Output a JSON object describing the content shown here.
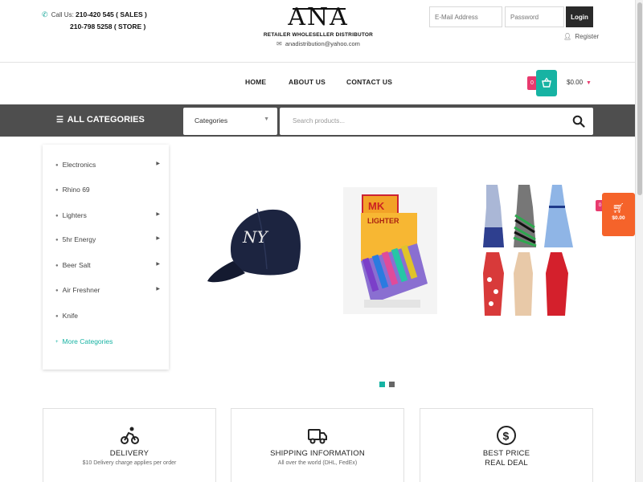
{
  "header": {
    "call_label": "Call Us:",
    "phone_sales": "210-420 545 ( SALES )",
    "phone_store": "210-798 5258 ( STORE )",
    "logo_text": "ANA",
    "tagline": "RETAILER WHOLESELLER DISTRIBUTOR",
    "email": "anadistribution@yahoo.com",
    "email_placeholder": "E-Mail Address",
    "password_placeholder": "Password",
    "login_label": "Login",
    "register_label": "Register"
  },
  "nav": {
    "items": [
      "HOME",
      "ABOUT US",
      "CONTACT US"
    ],
    "cart_count": "0",
    "cart_total": "$0.00"
  },
  "catbar": {
    "all_categories_label": "ALL CATEGORIES",
    "category_select_value": "Categories",
    "search_placeholder": "Search products..."
  },
  "sidebar": {
    "items": [
      {
        "label": "Electronics",
        "has_submenu": true
      },
      {
        "label": "Rhino 69",
        "has_submenu": false
      },
      {
        "label": "Lighters",
        "has_submenu": true
      },
      {
        "label": "5hr Energy",
        "has_submenu": true
      },
      {
        "label": "Beer Salt",
        "has_submenu": true
      },
      {
        "label": "Air Freshner",
        "has_submenu": true
      },
      {
        "label": "Knife",
        "has_submenu": false
      }
    ],
    "more_label": "More Categories"
  },
  "slider": {
    "products": [
      "cap",
      "lighter-box",
      "dresses"
    ],
    "active_index": 0,
    "count": 2
  },
  "floating_cart": {
    "count": "0",
    "total": "$0.00"
  },
  "features": [
    {
      "icon": "delivery-icon",
      "title": "DELIVERY",
      "subtitle": "$10 Delivery charge applies per order"
    },
    {
      "icon": "truck-icon",
      "title": "SHIPPING INFORMATION",
      "subtitle": "All over the world (DHL, FedEx)"
    },
    {
      "icon": "dollar-icon",
      "title": "BEST PRICE\nREAL DEAL",
      "subtitle": ""
    }
  ],
  "colors": {
    "accent": "#17b3a3",
    "badge": "#e83a6e",
    "floating_cart": "#f5632a",
    "catbar": "#4e4e4e"
  }
}
